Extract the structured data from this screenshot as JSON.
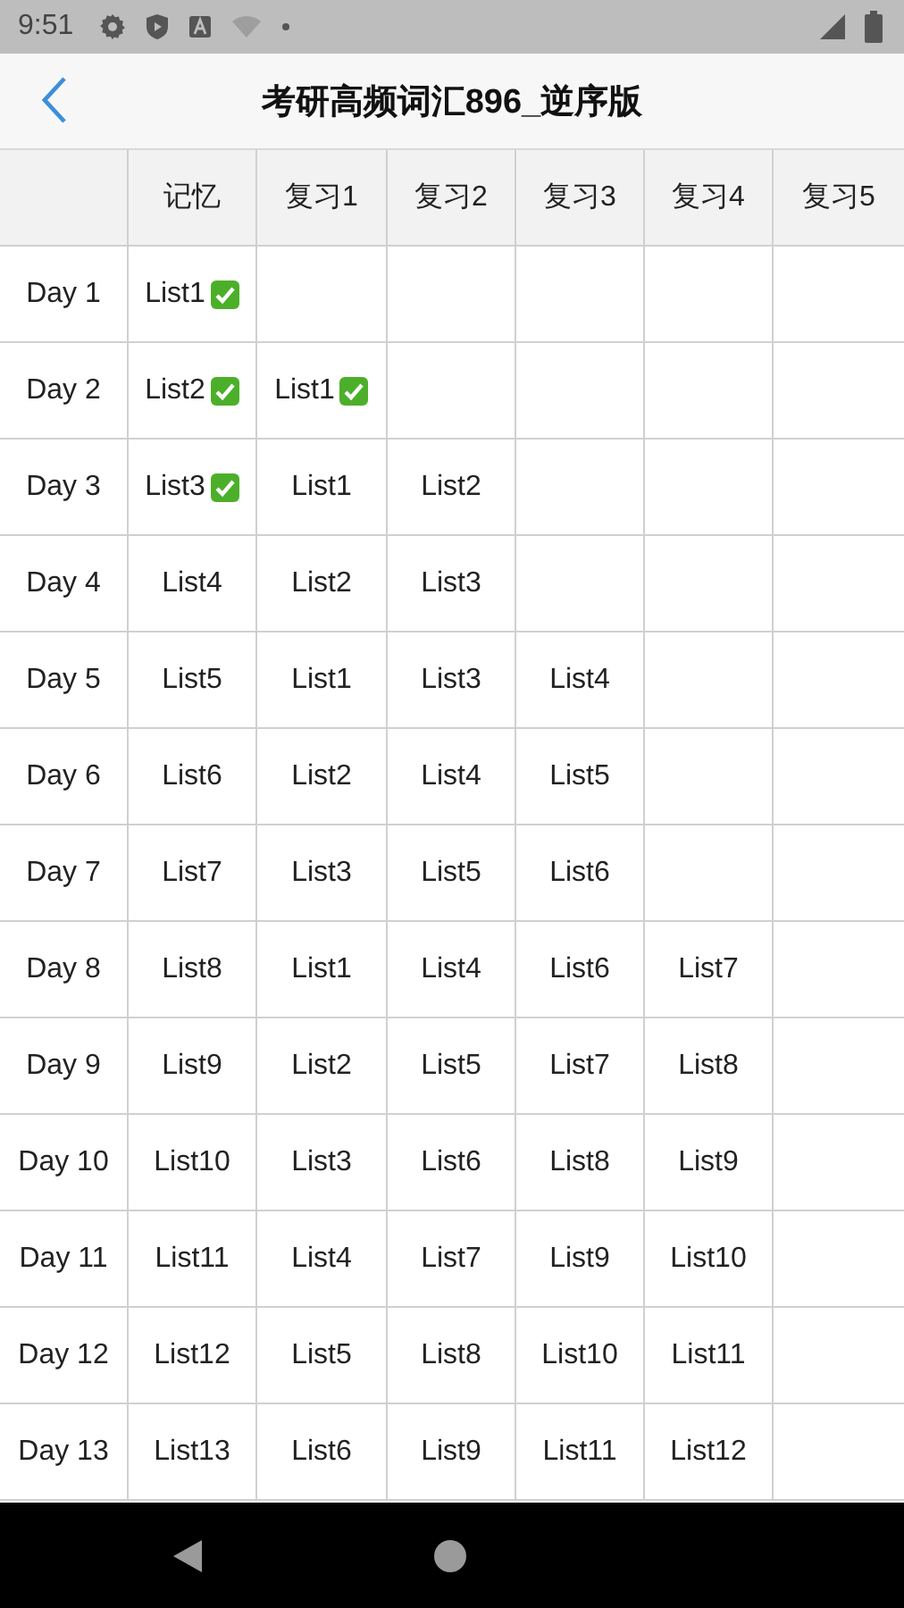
{
  "status_bar": {
    "time": "9:51"
  },
  "header": {
    "title": "考研高频词汇896_逆序版"
  },
  "table": {
    "columns": [
      "记忆",
      "复习1",
      "复习2",
      "复习3",
      "复习4",
      "复习5"
    ],
    "rows": [
      {
        "day": "Day 1",
        "cells": [
          {
            "text": "List1",
            "done": true
          }
        ]
      },
      {
        "day": "Day 2",
        "cells": [
          {
            "text": "List2",
            "done": true
          },
          {
            "text": "List1",
            "done": true
          }
        ]
      },
      {
        "day": "Day 3",
        "cells": [
          {
            "text": "List3",
            "done": true
          },
          {
            "text": "List1",
            "done": false
          },
          {
            "text": "List2",
            "done": false
          }
        ]
      },
      {
        "day": "Day 4",
        "cells": [
          {
            "text": "List4",
            "done": false
          },
          {
            "text": "List2",
            "done": false
          },
          {
            "text": "List3",
            "done": false
          }
        ]
      },
      {
        "day": "Day 5",
        "cells": [
          {
            "text": "List5",
            "done": false
          },
          {
            "text": "List1",
            "done": false
          },
          {
            "text": "List3",
            "done": false
          },
          {
            "text": "List4",
            "done": false
          }
        ]
      },
      {
        "day": "Day 6",
        "cells": [
          {
            "text": "List6",
            "done": false
          },
          {
            "text": "List2",
            "done": false
          },
          {
            "text": "List4",
            "done": false
          },
          {
            "text": "List5",
            "done": false
          }
        ]
      },
      {
        "day": "Day 7",
        "cells": [
          {
            "text": "List7",
            "done": false
          },
          {
            "text": "List3",
            "done": false
          },
          {
            "text": "List5",
            "done": false
          },
          {
            "text": "List6",
            "done": false
          }
        ]
      },
      {
        "day": "Day 8",
        "cells": [
          {
            "text": "List8",
            "done": false
          },
          {
            "text": "List1",
            "done": false
          },
          {
            "text": "List4",
            "done": false
          },
          {
            "text": "List6",
            "done": false
          },
          {
            "text": "List7",
            "done": false
          }
        ]
      },
      {
        "day": "Day 9",
        "cells": [
          {
            "text": "List9",
            "done": false
          },
          {
            "text": "List2",
            "done": false
          },
          {
            "text": "List5",
            "done": false
          },
          {
            "text": "List7",
            "done": false
          },
          {
            "text": "List8",
            "done": false
          }
        ]
      },
      {
        "day": "Day 10",
        "cells": [
          {
            "text": "List10",
            "done": false
          },
          {
            "text": "List3",
            "done": false
          },
          {
            "text": "List6",
            "done": false
          },
          {
            "text": "List8",
            "done": false
          },
          {
            "text": "List9",
            "done": false
          }
        ]
      },
      {
        "day": "Day 11",
        "cells": [
          {
            "text": "List11",
            "done": false
          },
          {
            "text": "List4",
            "done": false
          },
          {
            "text": "List7",
            "done": false
          },
          {
            "text": "List9",
            "done": false
          },
          {
            "text": "List10",
            "done": false
          }
        ]
      },
      {
        "day": "Day 12",
        "cells": [
          {
            "text": "List12",
            "done": false
          },
          {
            "text": "List5",
            "done": false
          },
          {
            "text": "List8",
            "done": false
          },
          {
            "text": "List10",
            "done": false
          },
          {
            "text": "List11",
            "done": false
          }
        ]
      },
      {
        "day": "Day 13",
        "cells": [
          {
            "text": "List13",
            "done": false
          },
          {
            "text": "List6",
            "done": false
          },
          {
            "text": "List9",
            "done": false
          },
          {
            "text": "List11",
            "done": false
          },
          {
            "text": "List12",
            "done": false
          }
        ]
      }
    ]
  }
}
